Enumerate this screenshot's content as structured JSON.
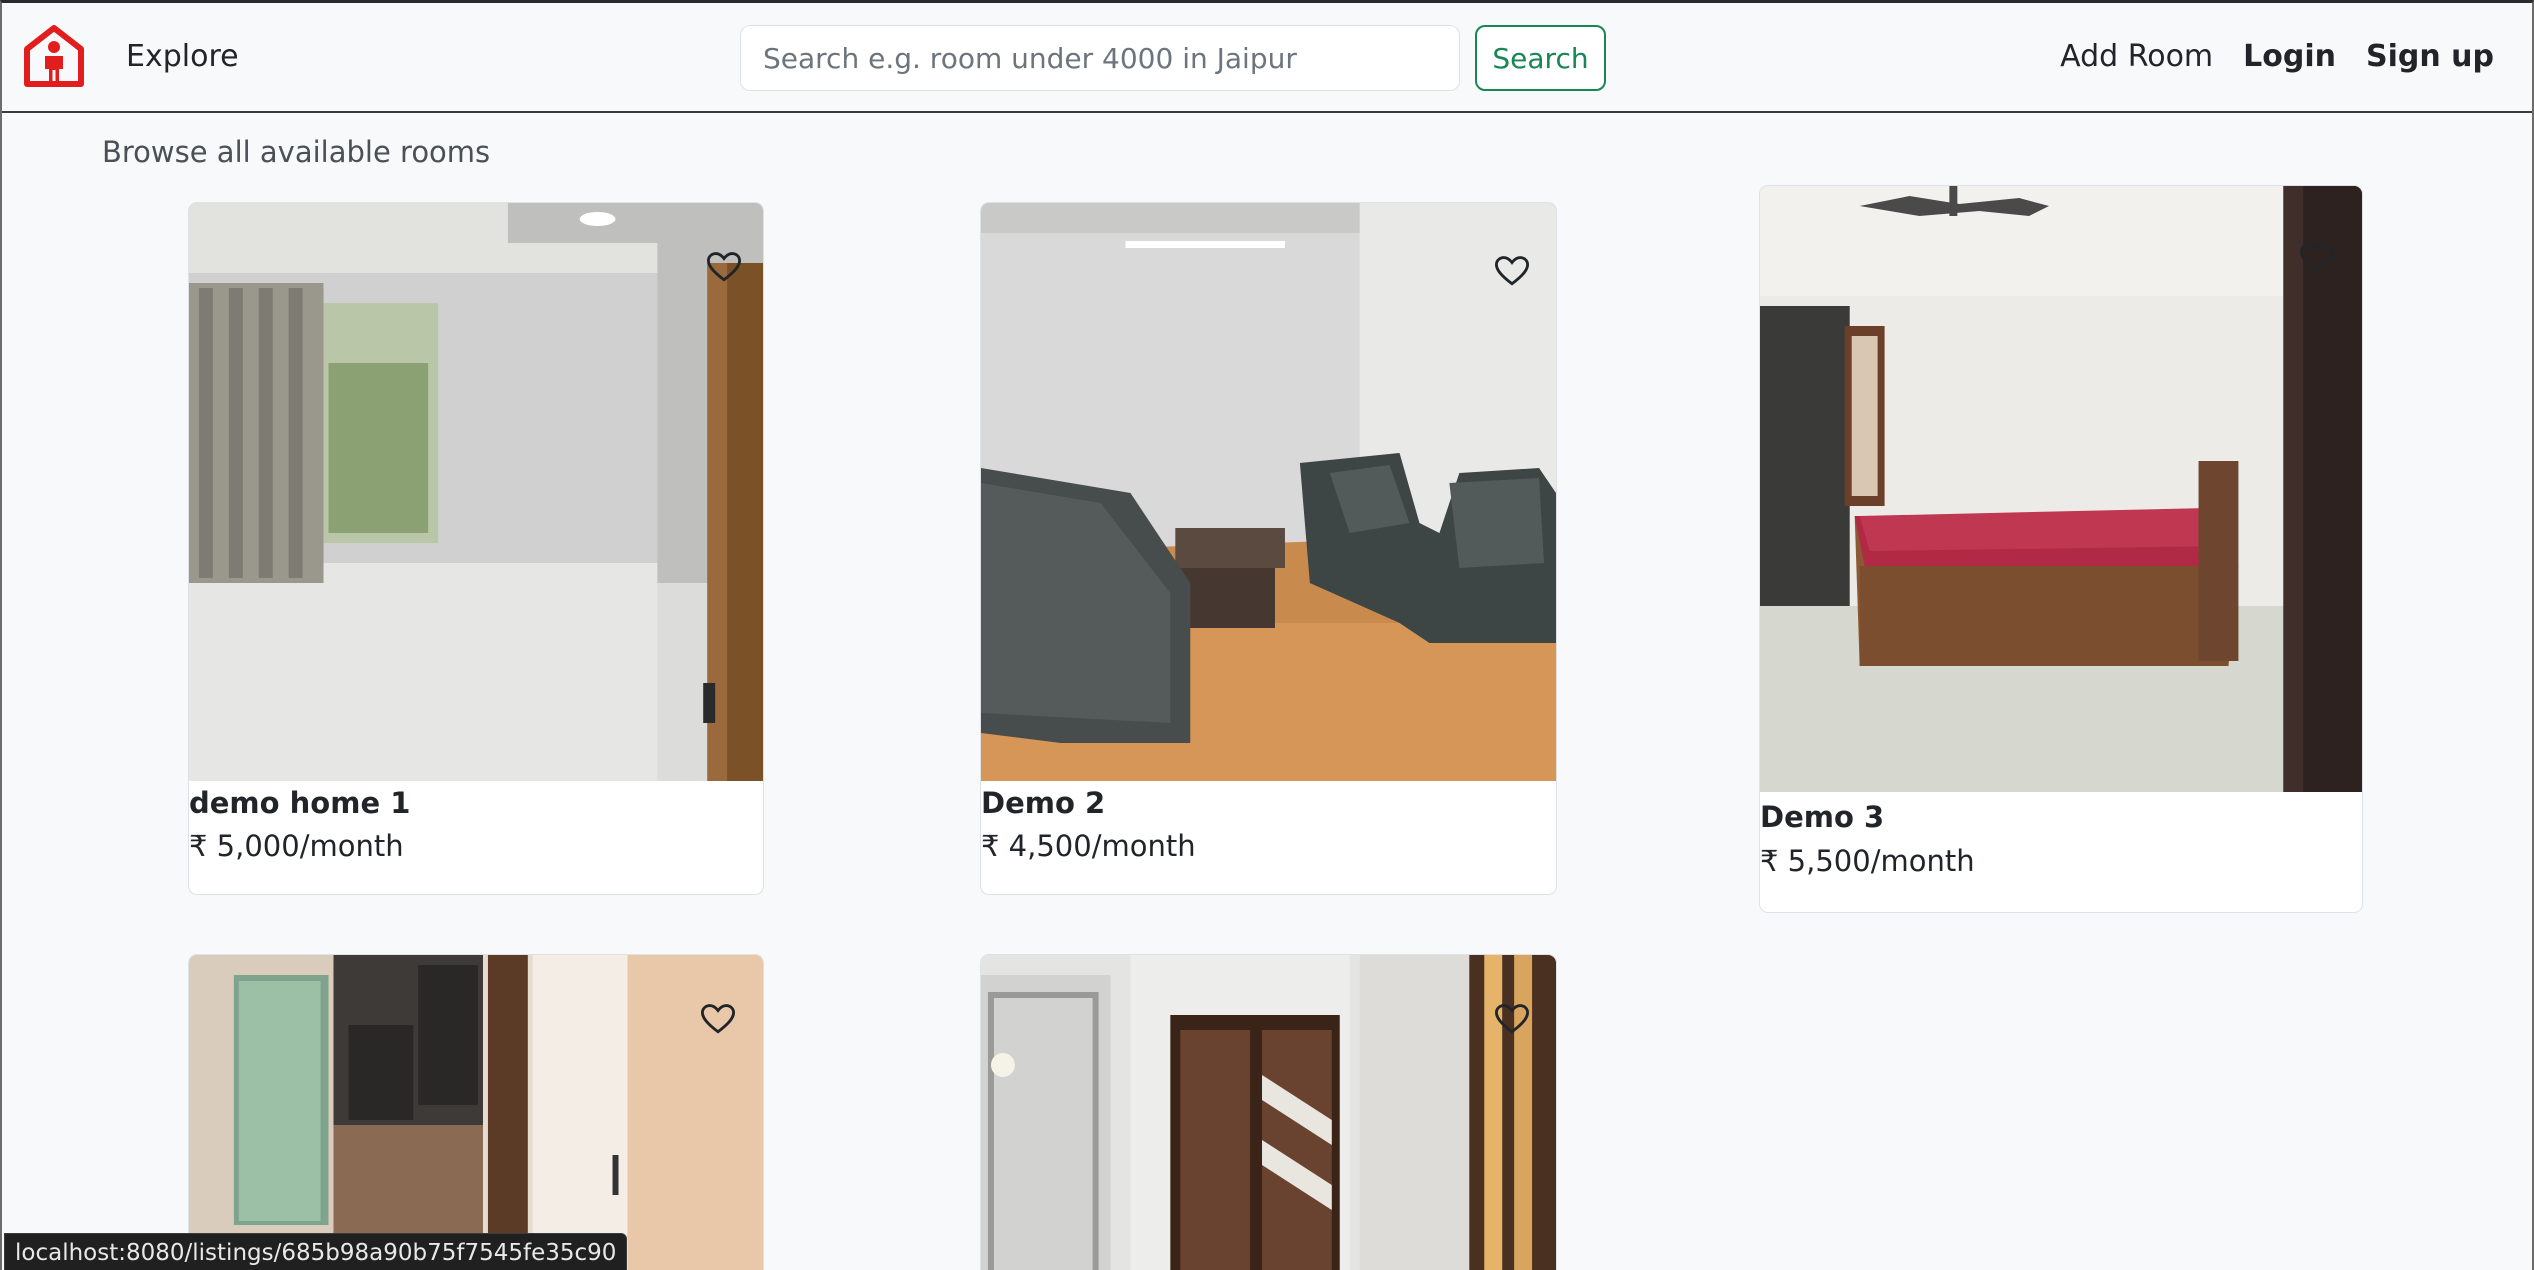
{
  "navbar": {
    "logo_icon": "house-person-icon",
    "brand_color": "#e11d1d",
    "explore_label": "Explore",
    "search": {
      "placeholder": "Search e.g. room under 4000 in Jaipur",
      "value": "",
      "button_label": "Search"
    },
    "add_room_label": "Add Room",
    "login_label": "Login",
    "signup_label": "Sign up"
  },
  "main": {
    "browse_label": "Browse all available rooms",
    "listings": [
      {
        "title": "demo home 1",
        "price": "₹ 5,000/month",
        "heart_icon": "heart-outline-icon"
      },
      {
        "title": "Demo 2",
        "price": "₹ 4,500/month",
        "heart_icon": "heart-outline-icon"
      },
      {
        "title": "Demo 3",
        "price": "₹ 5,500/month",
        "heart_icon": "heart-outline-icon"
      },
      {
        "title": "",
        "price": "",
        "heart_icon": "heart-outline-icon"
      },
      {
        "title": "",
        "price": "",
        "heart_icon": "heart-outline-icon"
      }
    ]
  },
  "status_bar": {
    "url": "localhost:8080/listings/685b98a90b75f7545fe35c90"
  },
  "colors": {
    "accent_green": "#198754",
    "page_bg": "#f8f9fa"
  }
}
